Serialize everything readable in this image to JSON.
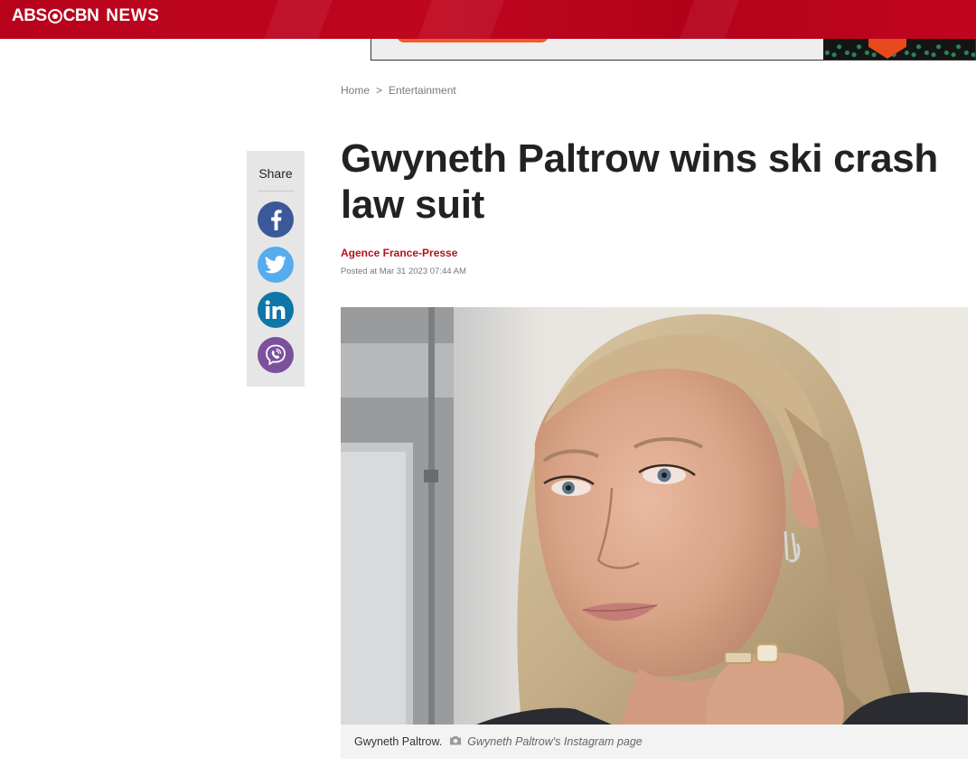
{
  "header": {
    "logo_abs": "ABS",
    "logo_cbn": "CBN",
    "logo_news": "NEWS",
    "brand_color": "#c0061f"
  },
  "breadcrumb": {
    "home": "Home",
    "separator": ">",
    "section": "Entertainment"
  },
  "share": {
    "label": "Share",
    "buttons": [
      {
        "name": "facebook",
        "icon": "facebook-icon",
        "color": "#3b5998"
      },
      {
        "name": "twitter",
        "icon": "twitter-icon",
        "color": "#55acee"
      },
      {
        "name": "linkedin",
        "icon": "linkedin-icon",
        "color": "#0e76a8"
      },
      {
        "name": "viber",
        "icon": "viber-icon",
        "color": "#7b519d"
      }
    ]
  },
  "article": {
    "title": "Gwyneth Paltrow wins ski crash law suit",
    "author": "Agence France-Presse",
    "posted": "Posted at Mar 31 2023 07:44 AM",
    "image_caption": "Gwyneth Paltrow.",
    "image_credit": "Gwyneth Paltrow's Instagram page"
  }
}
